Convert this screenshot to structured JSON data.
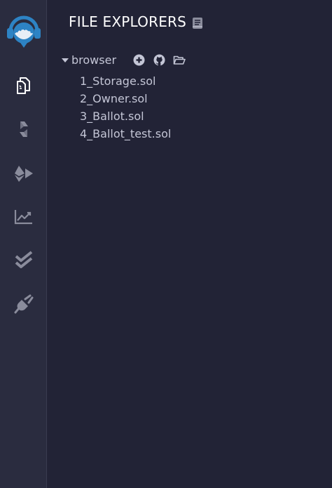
{
  "app": {
    "colors": {
      "background": "#222336",
      "icon_panel": "#2a2c3f",
      "accent": "#2d83c4",
      "text": "#c4c6d6",
      "icon_active": "#ffffff",
      "icon_inactive": "#8a8c9c"
    }
  },
  "sidebar": {
    "logo_icon": "remix-logo-icon",
    "items": [
      {
        "icon": "file-explorer-icon",
        "active": true
      },
      {
        "icon": "solidity-compiler-icon",
        "active": false
      },
      {
        "icon": "deploy-run-icon",
        "active": false
      },
      {
        "icon": "analysis-chart-icon",
        "active": false
      },
      {
        "icon": "testing-check-icon",
        "active": false
      },
      {
        "icon": "plugin-manager-icon",
        "active": false
      }
    ]
  },
  "panel": {
    "title": "FILE EXPLORERS",
    "title_icon": "documentation-icon"
  },
  "tree": {
    "root_label": "browser",
    "actions": [
      {
        "icon": "create-file-icon"
      },
      {
        "icon": "github-icon"
      },
      {
        "icon": "open-folder-icon"
      }
    ],
    "files": [
      "1_Storage.sol",
      "2_Owner.sol",
      "3_Ballot.sol",
      "4_Ballot_test.sol"
    ]
  }
}
